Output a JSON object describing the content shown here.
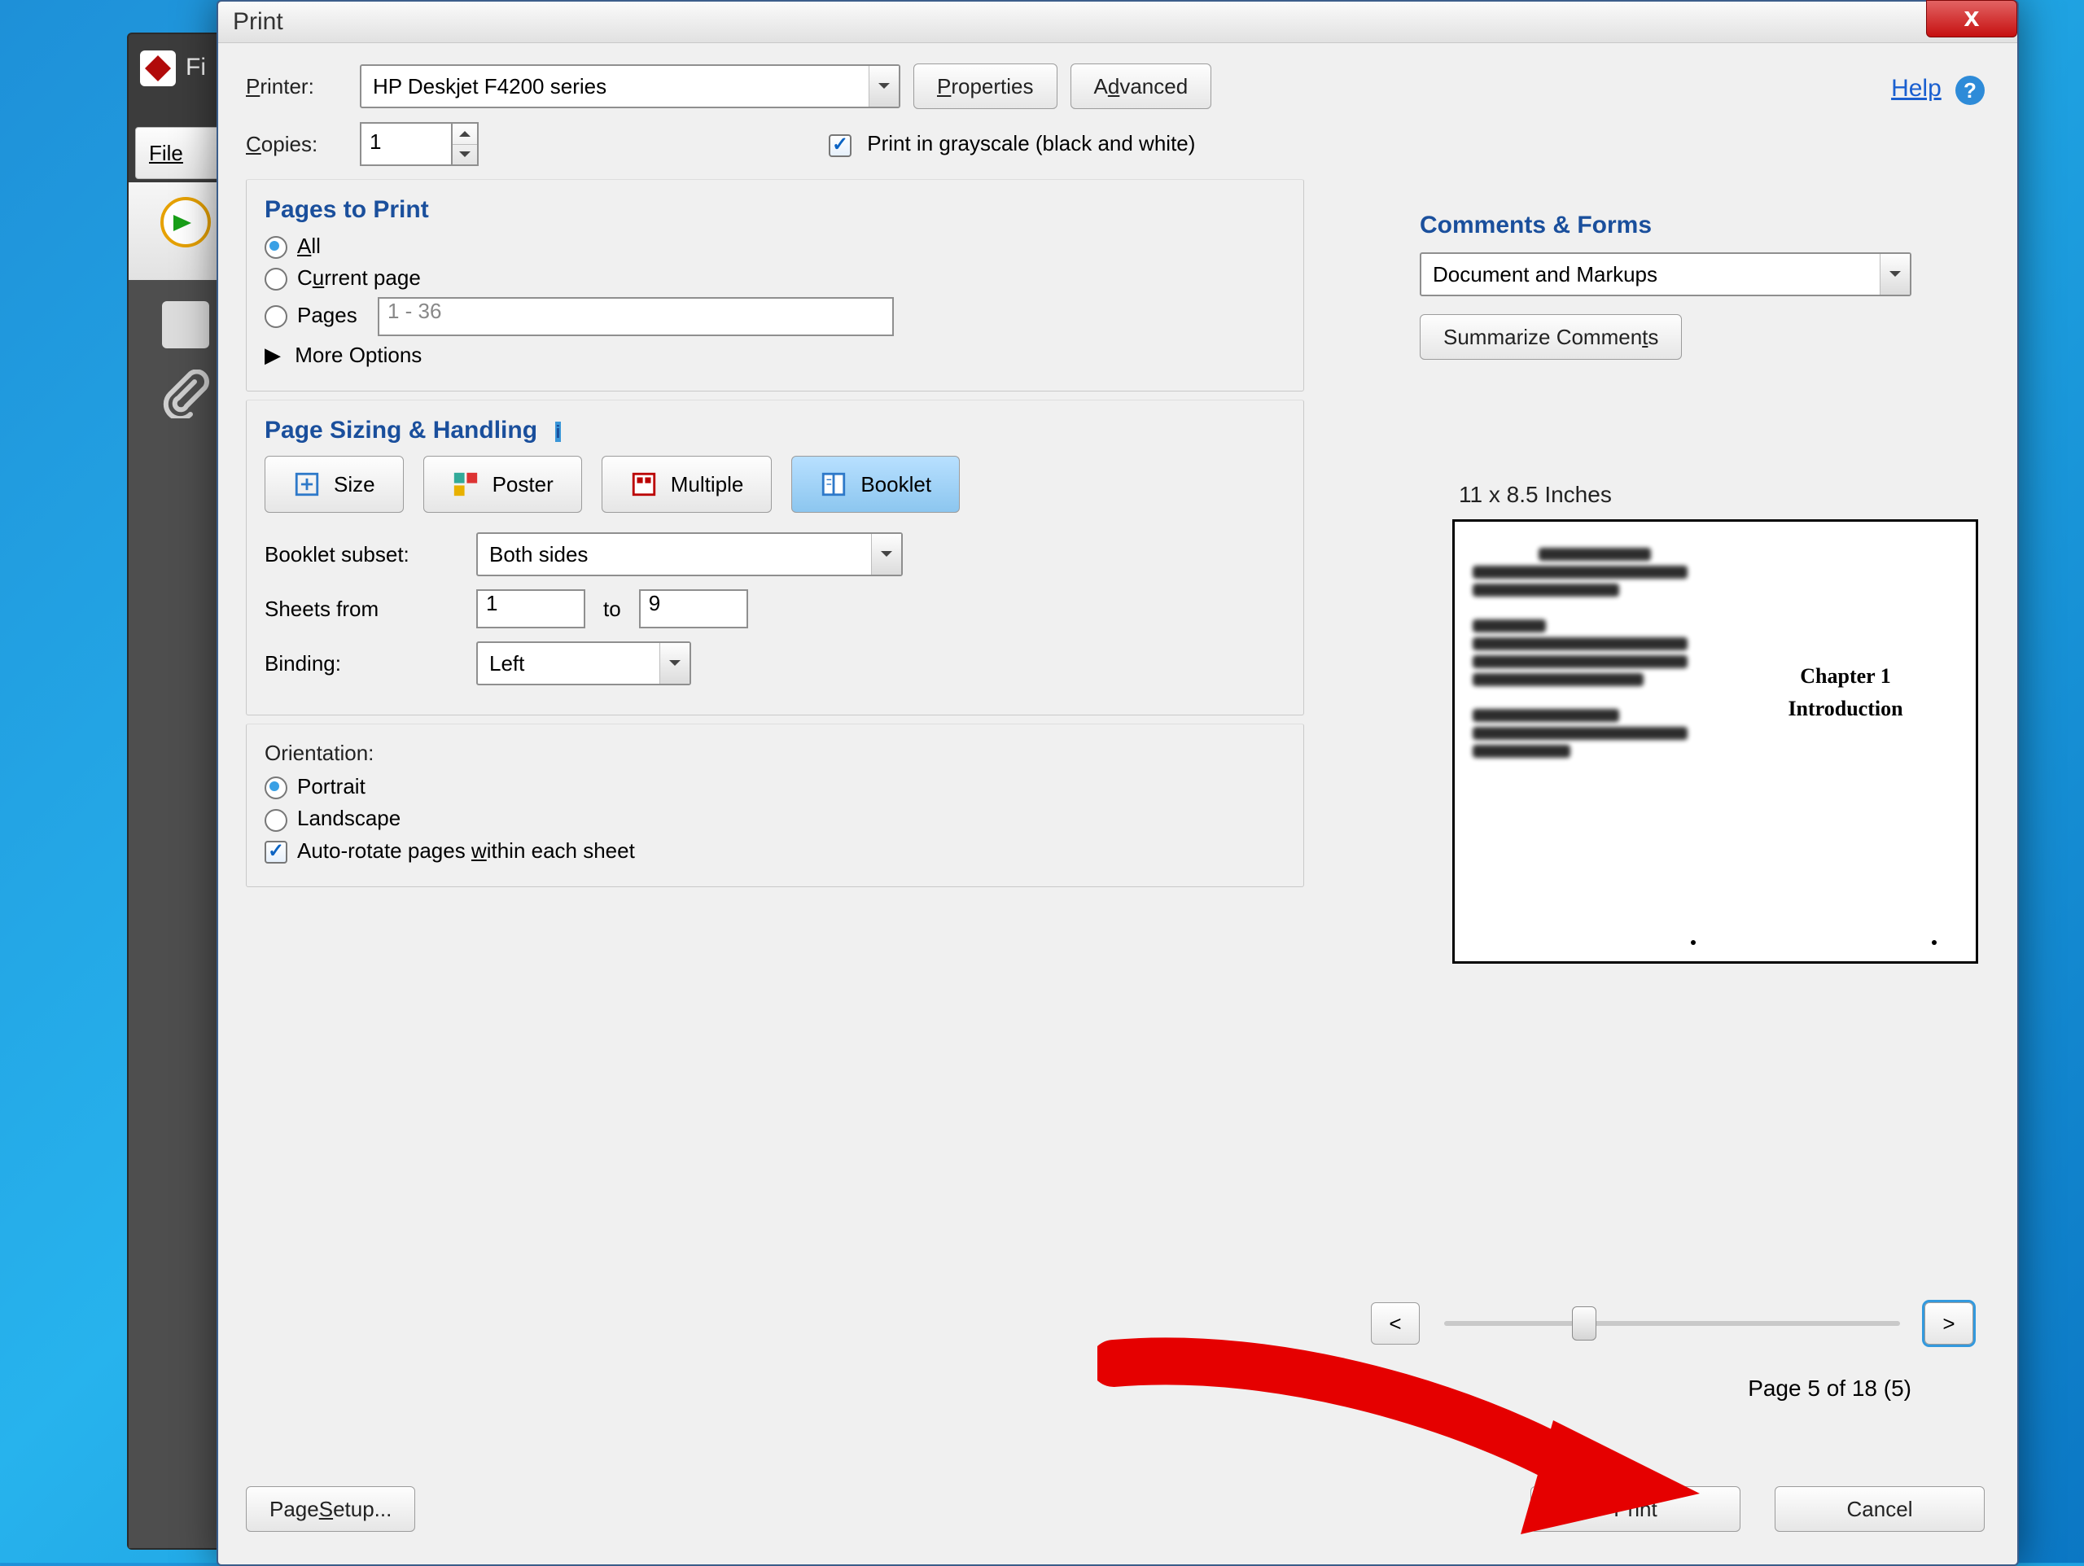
{
  "bgWindow": {
    "title": "Fi",
    "menuFile": "File"
  },
  "dialog": {
    "title": "Print",
    "help": "Help"
  },
  "printer": {
    "label": "Printer:",
    "value": "HP Deskjet F4200 series",
    "properties": "Properties",
    "advanced": "Advanced"
  },
  "copies": {
    "label": "Copies:",
    "value": "1"
  },
  "grayscale": {
    "checked": true,
    "label": "Print in grayscale (black and white)"
  },
  "pagesToPrint": {
    "header": "Pages to Print",
    "all": "All",
    "current": "Current page",
    "pagesLabel": "Pages",
    "pagesValue": "1 - 36",
    "more": "More Options",
    "selected": "all"
  },
  "sizing": {
    "header": "Page Sizing & Handling",
    "modes": {
      "size": "Size",
      "poster": "Poster",
      "multiple": "Multiple",
      "booklet": "Booklet"
    },
    "selected": "booklet",
    "bookletSubsetLabel": "Booklet subset:",
    "bookletSubset": "Both sides",
    "sheetsFromLabel": "Sheets from",
    "sheetsFrom": "1",
    "sheetsToLabel": "to",
    "sheetsTo": "9",
    "bindingLabel": "Binding:",
    "binding": "Left"
  },
  "orientation": {
    "header": "Orientation:",
    "portrait": "Portrait",
    "landscape": "Landscape",
    "selected": "portrait",
    "autorotate": {
      "checked": true,
      "label": "Auto-rotate pages within each sheet"
    }
  },
  "commentsForms": {
    "header": "Comments & Forms",
    "value": "Document and Markups",
    "summarize": "Summarize Comments"
  },
  "preview": {
    "paperSize": "11 x 8.5 Inches",
    "chapterLine1": "Chapter 1",
    "chapterLine2": "Introduction",
    "pageLabel": "Page 5 of 18 (5)",
    "prev": "<",
    "next": ">"
  },
  "footer": {
    "pageSetup": "Page Setup...",
    "print": "Print",
    "cancel": "Cancel"
  }
}
